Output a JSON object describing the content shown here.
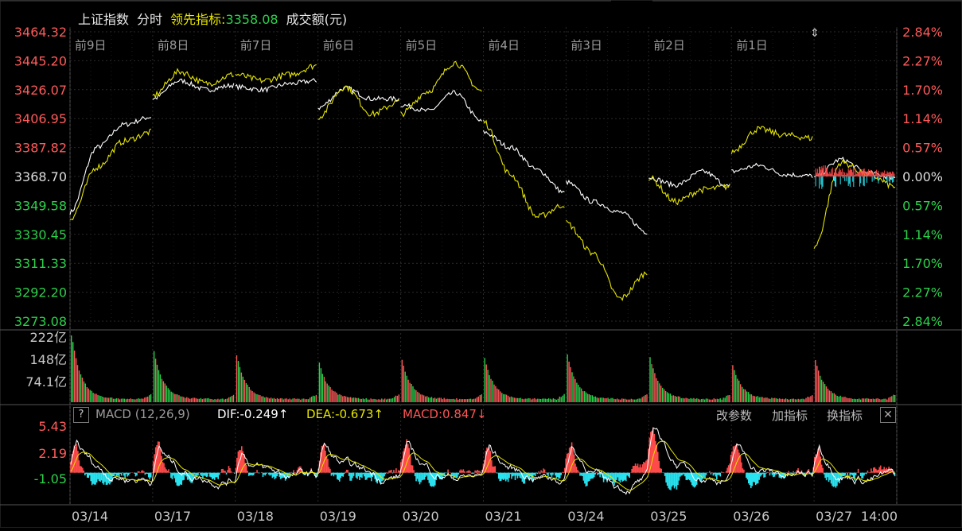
{
  "header": {
    "index_name": "上证指数",
    "mode": "分时",
    "leading_label": "领先指标:",
    "leading_value": "3358.08",
    "volume_label": "成交额(元)"
  },
  "price_axis": [
    "3464.32",
    "3445.20",
    "3426.07",
    "3406.95",
    "3387.82",
    "3368.70",
    "3349.58",
    "3330.45",
    "3311.33",
    "3292.20",
    "3273.08"
  ],
  "pct_axis": [
    "2.84%",
    "2.27%",
    "1.70%",
    "1.14%",
    "0.57%",
    "0.00%",
    "0.57%",
    "1.14%",
    "1.70%",
    "2.27%",
    "2.84%"
  ],
  "day_labels": [
    "前9日",
    "前8日",
    "前7日",
    "前6日",
    "前5日",
    "前4日",
    "前3日",
    "前2日",
    "前1日"
  ],
  "volume_axis": [
    "222亿",
    "148亿",
    "74.1亿"
  ],
  "macd": {
    "help": "?",
    "name": "MACD (12,26,9)",
    "dif": "DIF:-0.249↑",
    "dea": "DEA:-0.673↑",
    "macd": "MACD:0.847↓",
    "axis": [
      "5.43",
      "2.19",
      "-1.05"
    ],
    "change_params": "改参数",
    "add_indicator": "加指标",
    "switch_indicator": "换指标",
    "close": "✕"
  },
  "date_labels": [
    "03/14",
    "03/17",
    "03/18",
    "03/19",
    "03/20",
    "03/21",
    "03/24",
    "03/25",
    "03/26",
    "03/27",
    "14:00"
  ],
  "chart_data": {
    "type": "line",
    "title": "上证指数 分时",
    "ylim": [
      3273.08,
      3464.32
    ],
    "base_price": 3368.7,
    "leading_indicator_current": 3358.08,
    "days": [
      "03/14",
      "03/17",
      "03/18",
      "03/19",
      "03/20",
      "03/21",
      "03/24",
      "03/25",
      "03/26",
      "03/27"
    ],
    "series": [
      {
        "name": "上证指数",
        "color": "#ffffff",
        "values": [
          [
            3345,
            3388,
            3403,
            3408
          ],
          [
            3420,
            3432,
            3426,
            3429
          ],
          [
            3428,
            3426,
            3430,
            3432
          ],
          [
            3414,
            3427,
            3420,
            3420
          ],
          [
            3416,
            3412,
            3424,
            3405
          ],
          [
            3398,
            3388,
            3373,
            3358
          ],
          [
            3365,
            3352,
            3345,
            3332
          ],
          [
            3368,
            3363,
            3372,
            3362
          ],
          [
            3372,
            3376,
            3370,
            3369
          ],
          [
            3368,
            3380,
            3371,
            3368
          ]
        ]
      },
      {
        "name": "领先指标",
        "color": "#e6e600",
        "values": [
          [
            3341,
            3375,
            3392,
            3398
          ],
          [
            3422,
            3438,
            3430,
            3436
          ],
          [
            3436,
            3432,
            3436,
            3442
          ],
          [
            3408,
            3428,
            3410,
            3418
          ],
          [
            3410,
            3425,
            3444,
            3425
          ],
          [
            3405,
            3370,
            3342,
            3350
          ],
          [
            3338,
            3318,
            3288,
            3305
          ],
          [
            3368,
            3352,
            3360,
            3362
          ],
          [
            3385,
            3400,
            3396,
            3394
          ],
          [
            3322,
            3378,
            3370,
            3362
          ]
        ]
      }
    ],
    "volume_peaks": [
      222,
      160,
      148,
      120,
      130,
      135,
      150,
      140,
      115,
      130
    ],
    "macd_ylim": [
      -4.0,
      6.5
    ],
    "macd_dif_now": -0.249,
    "macd_dea_now": -0.673,
    "macd_hist_now": 0.847
  }
}
